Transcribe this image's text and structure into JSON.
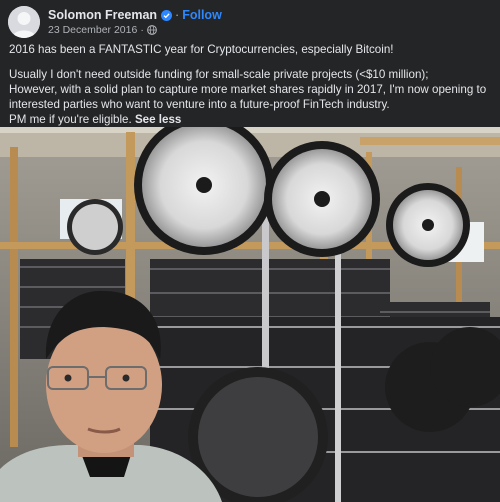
{
  "post": {
    "author": "Solomon Freeman",
    "follow_label": "Follow",
    "separator": "·",
    "date": "23 December 2016",
    "dot": "·",
    "verified_icon": "verified-badge-icon",
    "audience_icon": "globe-icon",
    "line1": "2016 has been a FANTASTIC year for Cryptocurrencies, especially Bitcoin!",
    "line2": "Usually I don't need outside funding for small-scale private projects (<$10 million);",
    "line3": "However, with a solid plan to capture more market shares rapidly in 2017, I'm now opening to",
    "line4": "interested parties who want to venture into a future-proof FinTech industry.",
    "line5": "PM me if you're eligible.",
    "see_less": "See less"
  },
  "colors": {
    "background": "#242526",
    "text": "#e4e6eb",
    "secondary_text": "#b0b3b8",
    "accent": "#2d88ff"
  }
}
